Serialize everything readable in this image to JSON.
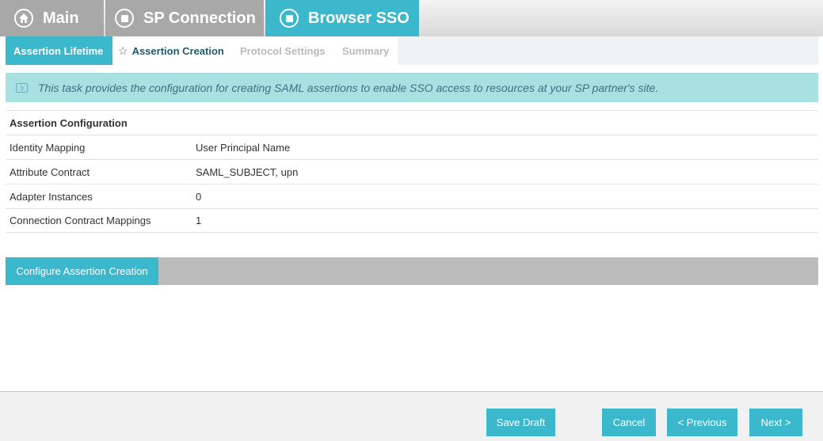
{
  "top_tabs": {
    "main": "Main",
    "sp_connection": "SP Connection",
    "browser_sso": "Browser SSO"
  },
  "sub_tabs": {
    "assertion_lifetime": "Assertion Lifetime",
    "assertion_creation": "Assertion Creation",
    "protocol_settings": "Protocol Settings",
    "summary": "Summary"
  },
  "info_banner": "This task provides the configuration for creating SAML assertions to enable SSO access to resources at your SP partner's site.",
  "summary_table": {
    "heading": "Assertion Configuration",
    "rows": [
      {
        "label": "Identity Mapping",
        "value": "User Principal Name"
      },
      {
        "label": "Attribute Contract",
        "value": "SAML_SUBJECT, upn"
      },
      {
        "label": "Adapter Instances",
        "value": "0"
      },
      {
        "label": "Connection Contract Mappings",
        "value": "1"
      }
    ]
  },
  "configure_button": "Configure Assertion Creation",
  "footer": {
    "save_draft": "Save Draft",
    "cancel": "Cancel",
    "previous": "< Previous",
    "next": "Next >"
  },
  "colors": {
    "accent": "#3bb8cc",
    "tab_inactive": "#a8a8a8",
    "banner_bg": "#a9e1e3"
  },
  "icons": {
    "main": "home-icon",
    "sp_connection": "square-circle-icon",
    "browser_sso": "square-circle-icon",
    "active_subtab": "star-icon",
    "banner": "info-arrow-icon"
  }
}
